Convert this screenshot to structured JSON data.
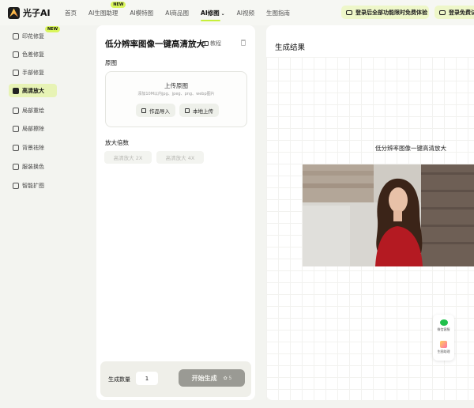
{
  "app": {
    "logo_text": "光子AI"
  },
  "nav": {
    "items": [
      {
        "label": "首页"
      },
      {
        "label": "AI生图助理",
        "badge": "NEW"
      },
      {
        "label": "AI模特图"
      },
      {
        "label": "AI商品图"
      },
      {
        "label": "AI修图",
        "active": true
      },
      {
        "label": "AI视频"
      },
      {
        "label": "生图指南"
      }
    ],
    "promo": "登录后全部功能限时免费体验",
    "login": "登录免费试"
  },
  "sidebar": {
    "items": [
      {
        "label": "印花修复",
        "badge": "NEW"
      },
      {
        "label": "色差修复"
      },
      {
        "label": "手部修复"
      },
      {
        "label": "高清放大",
        "active": true
      },
      {
        "label": "局部重绘"
      },
      {
        "label": "局部擦除"
      },
      {
        "label": "背景祛除"
      },
      {
        "label": "服装换色"
      },
      {
        "label": "智能扩图"
      }
    ]
  },
  "panel": {
    "title": "低分辨率图像一键高清放大",
    "tutorial": "教程",
    "original_label": "原图",
    "upload_title": "上传原图",
    "upload_hint": "添加10M以内jpg、jpeg、png、webp图片",
    "import_btn": "作品导入",
    "local_upload_btn": "本地上传",
    "scale_label": "放大倍数",
    "scale_options": [
      "高清放大 2X",
      "高清放大 4X"
    ],
    "quantity_label": "生成数量",
    "quantity_value": "1",
    "generate_btn": "开始生成",
    "cost": "5"
  },
  "result": {
    "title": "生成结果",
    "caption": "低分辨率图像一键高清放大"
  },
  "float": {
    "service": "微信客服",
    "helper": "生图助理"
  },
  "colors": {
    "accent": "#c7ef3a",
    "active_bg": "#e7f3b5",
    "promo_bg": "#eef7c9",
    "generate_btn": "#9a9a94"
  }
}
